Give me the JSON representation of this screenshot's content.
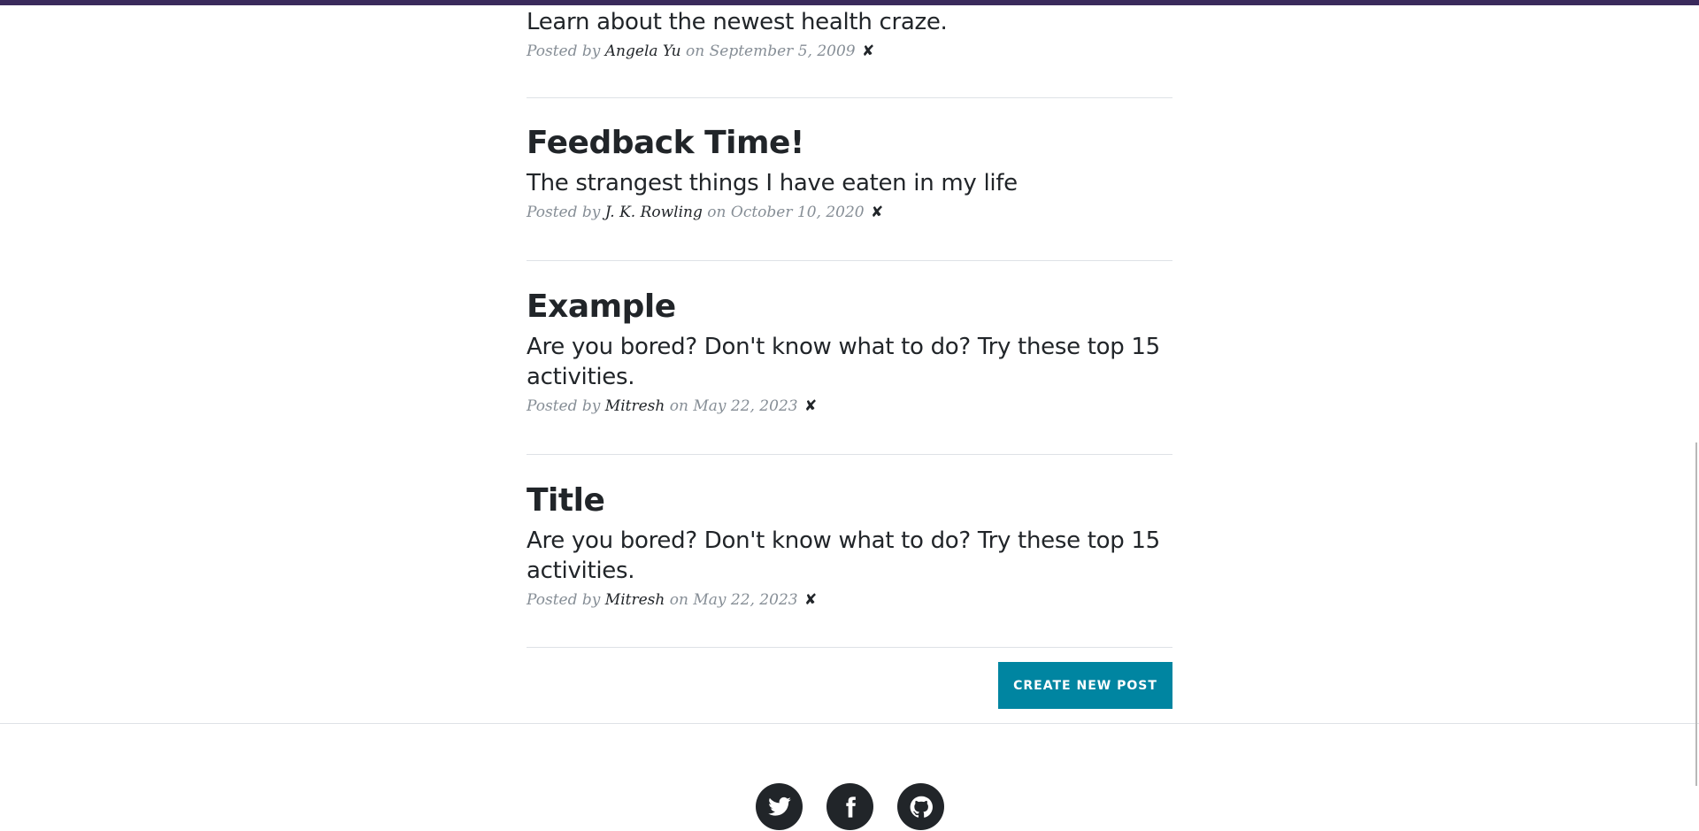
{
  "posts": [
    {
      "title": "",
      "subtitle": "Learn about the newest health craze.",
      "posted_by": "Posted by",
      "author": "Angela Yu",
      "date": "on September 5, 2009",
      "delete": "✘"
    },
    {
      "title": "Feedback Time!",
      "subtitle": "The strangest things I have eaten in my life",
      "posted_by": "Posted by",
      "author": "J. K. Rowling",
      "date": "on October 10, 2020",
      "delete": "✘"
    },
    {
      "title": "Example",
      "subtitle": "Are you bored? Don't know what to do? Try these top 15 activities.",
      "posted_by": "Posted by",
      "author": "Mitresh",
      "date": "on May 22, 2023",
      "delete": "✘"
    },
    {
      "title": "Title",
      "subtitle": "Are you bored? Don't know what to do? Try these top 15 activities.",
      "posted_by": "Posted by",
      "author": "Mitresh",
      "date": "on May 22, 2023",
      "delete": "✘"
    }
  ],
  "create_button": "Create New Post",
  "social": [
    "twitter-icon",
    "facebook-icon",
    "github-icon"
  ],
  "colors": {
    "accent": "#0085a1",
    "text": "#212529",
    "meta": "#868e96",
    "top_bar": "#3a2a5c"
  }
}
